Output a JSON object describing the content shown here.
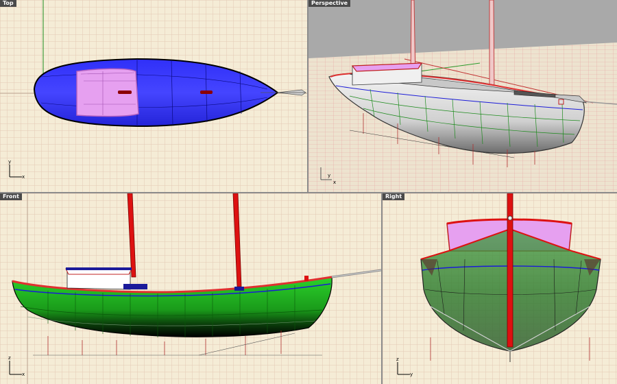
{
  "viewports": {
    "top": {
      "label": "Top",
      "axis_h": "x",
      "axis_v": "y"
    },
    "perspective": {
      "label": "Perspective",
      "axis_h": "x",
      "axis_v": "y"
    },
    "front": {
      "label": "Front",
      "axis_h": "x",
      "axis_v": "z"
    },
    "right": {
      "label": "Right",
      "axis_h": "y",
      "axis_v": "z"
    }
  },
  "colors": {
    "ortho_background": "#f5ecd6",
    "grid_minor": "#e2c9b4",
    "grid_major": "#b9a18d",
    "perspective_background": "#a9a9a9",
    "perspective_floor": "#ede3cf",
    "hull_top": "#2b2bf0",
    "cabin": "#e6a0f0",
    "hull_front": "#1db31d",
    "sheer_line": "#e03030",
    "mast": "#dd1111",
    "waterline": "#1a1ad8"
  }
}
